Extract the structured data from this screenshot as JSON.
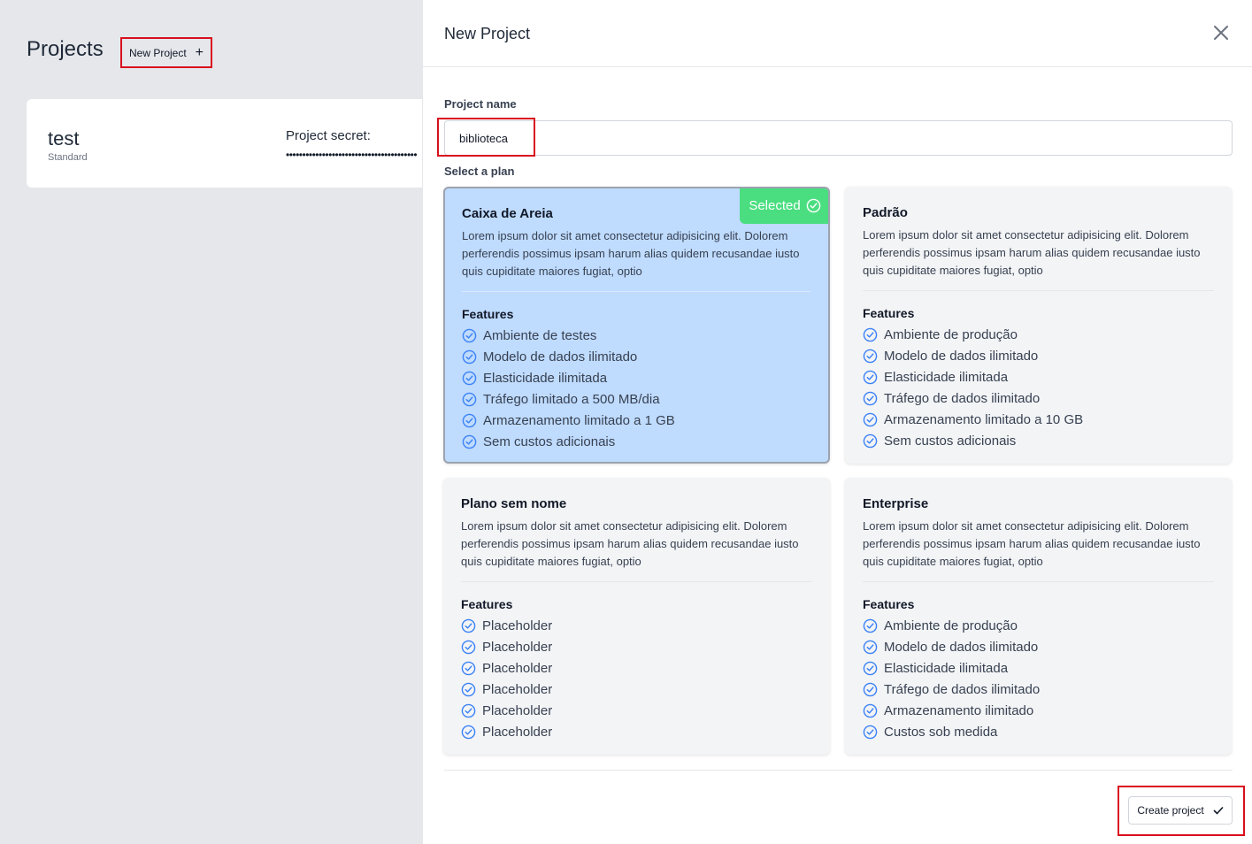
{
  "background": {
    "page_title": "Projects",
    "new_project_label": "New Project",
    "new_project_icon": "plus-icon",
    "project": {
      "name": "test",
      "tier": "Standard",
      "secret_label": "Project secret:",
      "secret_mask": "••••••••••••••••••••••••••••••••••••••••"
    }
  },
  "modal": {
    "title": "New Project",
    "close_icon": "close-icon",
    "project_name_label": "Project name",
    "project_name_value": "biblioteca",
    "select_plan_label": "Select a plan",
    "selected_badge": "Selected",
    "create_label": "Create project",
    "create_icon": "check-icon",
    "plans": [
      {
        "name": "Caixa de Areia",
        "selected": true,
        "description": "Lorem ipsum dolor sit amet consectetur adipisicing elit. Dolorem perferendis possimus ipsam harum alias quidem recusandae iusto quis cupiditate maiores fugiat, optio",
        "features_title": "Features",
        "features": [
          "Ambiente de testes",
          "Modelo de dados ilimitado",
          "Elasticidade ilimitada",
          "Tráfego limitado a 500 MB/dia",
          "Armazenamento limitado a 1 GB",
          "Sem custos adicionais"
        ]
      },
      {
        "name": "Padrão",
        "selected": false,
        "description": "Lorem ipsum dolor sit amet consectetur adipisicing elit. Dolorem perferendis possimus ipsam harum alias quidem recusandae iusto quis cupiditate maiores fugiat, optio",
        "features_title": "Features",
        "features": [
          "Ambiente de produção",
          "Modelo de dados ilimitado",
          "Elasticidade ilimitada",
          "Tráfego de dados ilimitado",
          "Armazenamento limitado a 10 GB",
          "Sem custos adicionais"
        ]
      },
      {
        "name": "Plano sem nome",
        "selected": false,
        "description": "Lorem ipsum dolor sit amet consectetur adipisicing elit. Dolorem perferendis possimus ipsam harum alias quidem recusandae iusto quis cupiditate maiores fugiat, optio",
        "features_title": "Features",
        "features": [
          "Placeholder",
          "Placeholder",
          "Placeholder",
          "Placeholder",
          "Placeholder",
          "Placeholder"
        ]
      },
      {
        "name": "Enterprise",
        "selected": false,
        "description": "Lorem ipsum dolor sit amet consectetur adipisicing elit. Dolorem perferendis possimus ipsam harum alias quidem recusandae iusto quis cupiditate maiores fugiat, optio",
        "features_title": "Features",
        "features": [
          "Ambiente de produção",
          "Modelo de dados ilimitado",
          "Elasticidade ilimitada",
          "Tráfego de dados ilimitado",
          "Armazenamento ilimitado",
          "Custos sob medida"
        ]
      }
    ]
  },
  "colors": {
    "selected_card": "#bfdbfe",
    "badge": "#4ade80",
    "check": "#3b82f6",
    "highlight": "#d90f1e"
  }
}
